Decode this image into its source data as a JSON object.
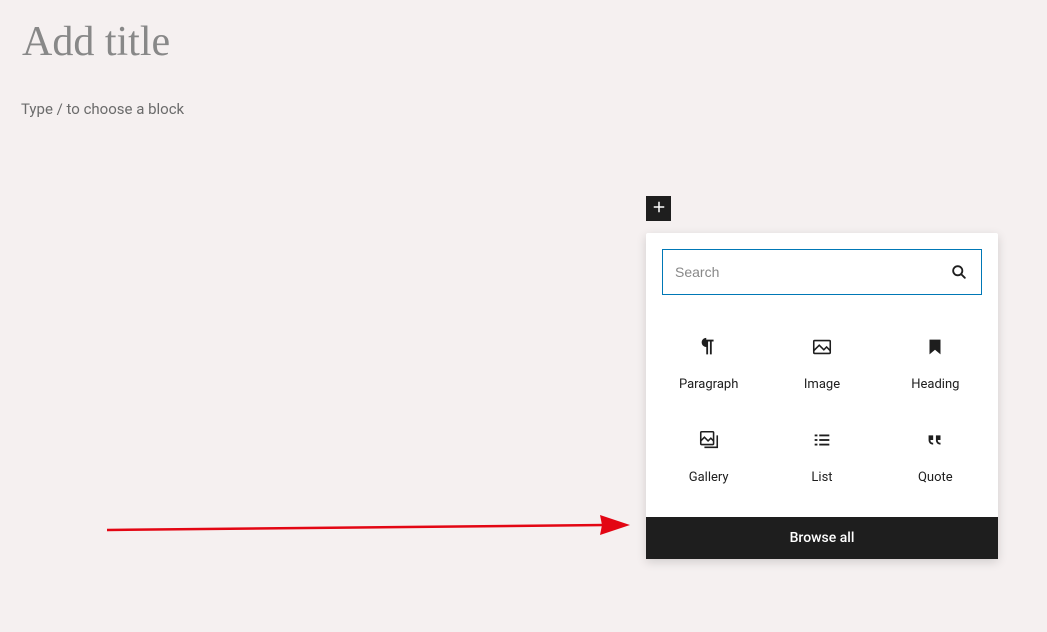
{
  "editor": {
    "title_placeholder": "Add title",
    "body_placeholder": "Type / to choose a block"
  },
  "inserter": {
    "search_placeholder": "Search",
    "blocks": [
      {
        "name": "paragraph",
        "label": "Paragraph"
      },
      {
        "name": "image",
        "label": "Image"
      },
      {
        "name": "heading",
        "label": "Heading"
      },
      {
        "name": "gallery",
        "label": "Gallery"
      },
      {
        "name": "list",
        "label": "List"
      },
      {
        "name": "quote",
        "label": "Quote"
      }
    ],
    "browse_all_label": "Browse all"
  },
  "annotation": {
    "arrow_color": "#e30613"
  }
}
